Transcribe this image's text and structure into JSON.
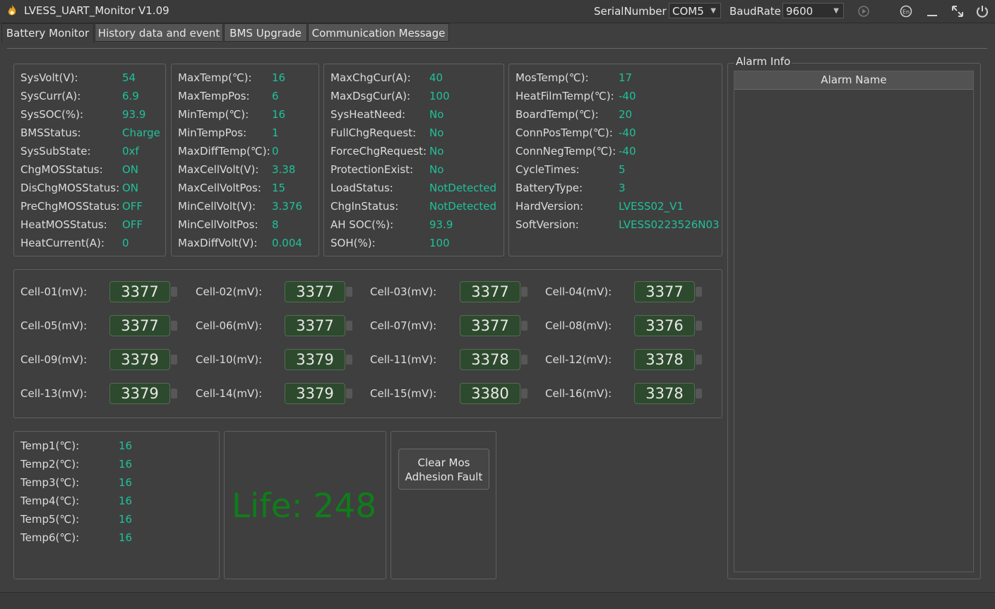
{
  "app": {
    "title": "LVESS_UART_Monitor V1.09",
    "serial_label": "SerialNumber",
    "serial_value": "COM5",
    "baud_label": "BaudRate",
    "baud_value": "9600",
    "icons": [
      "app-flame-icon",
      "play-icon",
      "language-en-icon",
      "minimize-icon",
      "maximize-icon",
      "power-icon"
    ]
  },
  "tabs": [
    {
      "label": "Battery Monitor"
    },
    {
      "label": "History data and event"
    },
    {
      "label": "BMS Upgrade"
    },
    {
      "label": "Communication Message"
    }
  ],
  "sys": [
    {
      "label": "SysVolt(V):",
      "value": "54"
    },
    {
      "label": "SysCurr(A):",
      "value": "6.9"
    },
    {
      "label": "SysSOC(%):",
      "value": "93.9"
    },
    {
      "label": "BMSStatus:",
      "value": "Charge"
    },
    {
      "label": "SysSubState:",
      "value": "0xf"
    },
    {
      "label": "ChgMOSStatus:",
      "value": "ON"
    },
    {
      "label": "DisChgMOSStatus:",
      "value": "ON"
    },
    {
      "label": "PreChgMOSStatus:",
      "value": "OFF"
    },
    {
      "label": "HeatMOSStatus:",
      "value": "OFF"
    },
    {
      "label": "HeatCurrent(A):",
      "value": "0"
    }
  ],
  "temps": [
    {
      "label": "MaxTemp(℃):",
      "value": "16"
    },
    {
      "label": "MaxTempPos:",
      "value": "6"
    },
    {
      "label": "MinTemp(℃):",
      "value": "16"
    },
    {
      "label": "MinTempPos:",
      "value": "1"
    },
    {
      "label": "MaxDiffTemp(℃):",
      "value": "0"
    },
    {
      "label": "MaxCellVolt(V):",
      "value": "3.38"
    },
    {
      "label": "MaxCellVoltPos:",
      "value": "15"
    },
    {
      "label": "MinCellVolt(V):",
      "value": "3.376"
    },
    {
      "label": "MinCellVoltPos:",
      "value": "8"
    },
    {
      "label": "MaxDiffVolt(V):",
      "value": "0.004"
    }
  ],
  "charge": [
    {
      "label": "MaxChgCur(A):",
      "value": "40"
    },
    {
      "label": "MaxDsgCur(A):",
      "value": "100"
    },
    {
      "label": "SysHeatNeed:",
      "value": "No"
    },
    {
      "label": "FullChgRequest:",
      "value": "No"
    },
    {
      "label": "ForceChgRequest:",
      "value": "No"
    },
    {
      "label": "ProtectionExist:",
      "value": "No"
    },
    {
      "label": "LoadStatus:",
      "value": "NotDetected"
    },
    {
      "label": "ChgInStatus:",
      "value": "NotDetected"
    },
    {
      "label": "AH SOC(%):",
      "value": "93.9"
    },
    {
      "label": "SOH(%):",
      "value": "100"
    }
  ],
  "board": [
    {
      "label": "MosTemp(℃):",
      "value": "17"
    },
    {
      "label": "HeatFilmTemp(℃):",
      "value": "-40"
    },
    {
      "label": "BoardTemp(℃):",
      "value": "20"
    },
    {
      "label": "ConnPosTemp(℃):",
      "value": "-40"
    },
    {
      "label": "ConnNegTemp(℃):",
      "value": "-40"
    },
    {
      "label": "CycleTimes:",
      "value": "5"
    },
    {
      "label": "BatteryType:",
      "value": "3"
    },
    {
      "label": "HardVersion:",
      "value": "LVESS02_V1"
    },
    {
      "label": "SoftVersion:",
      "value": "LVESS0223526N03"
    }
  ],
  "cells": [
    {
      "label": "Cell-01(mV):",
      "value": "3377"
    },
    {
      "label": "Cell-02(mV):",
      "value": "3377"
    },
    {
      "label": "Cell-03(mV):",
      "value": "3377"
    },
    {
      "label": "Cell-04(mV):",
      "value": "3377"
    },
    {
      "label": "Cell-05(mV):",
      "value": "3377"
    },
    {
      "label": "Cell-06(mV):",
      "value": "3377"
    },
    {
      "label": "Cell-07(mV):",
      "value": "3377"
    },
    {
      "label": "Cell-08(mV):",
      "value": "3376"
    },
    {
      "label": "Cell-09(mV):",
      "value": "3379"
    },
    {
      "label": "Cell-10(mV):",
      "value": "3379"
    },
    {
      "label": "Cell-11(mV):",
      "value": "3378"
    },
    {
      "label": "Cell-12(mV):",
      "value": "3378"
    },
    {
      "label": "Cell-13(mV):",
      "value": "3379"
    },
    {
      "label": "Cell-14(mV):",
      "value": "3379"
    },
    {
      "label": "Cell-15(mV):",
      "value": "3380"
    },
    {
      "label": "Cell-16(mV):",
      "value": "3378"
    }
  ],
  "temp_sensors": [
    {
      "label": "Temp1(℃):",
      "value": "16"
    },
    {
      "label": "Temp2(℃):",
      "value": "16"
    },
    {
      "label": "Temp3(℃):",
      "value": "16"
    },
    {
      "label": "Temp4(℃):",
      "value": "16"
    },
    {
      "label": "Temp5(℃):",
      "value": "16"
    },
    {
      "label": "Temp6(℃):",
      "value": "16"
    }
  ],
  "life_text": "Life: 248",
  "clear_button": {
    "line1": "Clear Mos",
    "line2": "Adhesion Fault"
  },
  "alarm": {
    "legend": "Alarm Info",
    "column": "Alarm Name"
  },
  "colors": {
    "value_green": "#1fc19a",
    "life_green": "#0f7d1a",
    "background": "#3f3f3f"
  }
}
